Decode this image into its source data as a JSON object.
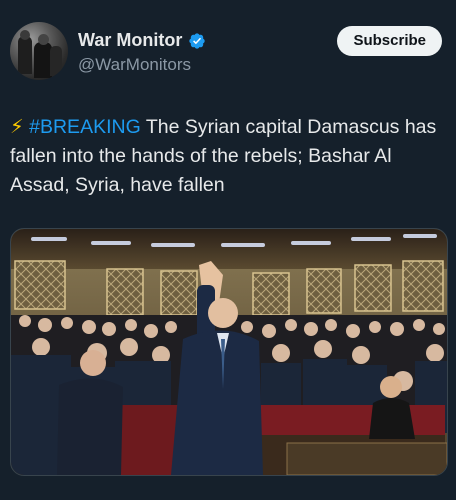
{
  "author": {
    "display_name": "War Monitor",
    "handle": "@WarMonitors",
    "verified_icon": "verified-badge-icon",
    "avatar_icon": "avatar-image"
  },
  "actions": {
    "subscribe_label": "Subscribe"
  },
  "tweet": {
    "emoji": "⚡",
    "hashtag": "#BREAKING",
    "body": " The Syrian capital Damascus has fallen into the hands of the rebels; Bashar Al Assad, Syria, have fallen"
  },
  "media": {
    "type": "photo"
  },
  "colors": {
    "background": "#15202b",
    "accent": "#1d9bf0",
    "text": "#e7e9ea",
    "secondary_text": "#8b98a5"
  }
}
